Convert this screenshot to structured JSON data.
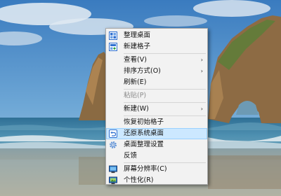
{
  "menu": {
    "items": [
      {
        "label": "整理桌面",
        "icon": "fences-organize-icon"
      },
      {
        "label": "新建格子",
        "icon": "fences-new-icon"
      },
      {
        "label": "查看(V)",
        "submenu": "chevron-right-icon"
      },
      {
        "label": "排序方式(O)",
        "submenu": "chevron-right-icon"
      },
      {
        "label": "刷新(E)"
      },
      {
        "label": "粘贴(P)",
        "state": "disabled"
      },
      {
        "label": "新建(W)",
        "submenu": "chevron-right-icon"
      },
      {
        "label": "恢复初始格子"
      },
      {
        "label": "还原系统桌面",
        "icon": "undo-icon",
        "state": "highlighted"
      },
      {
        "label": "桌面整理设置",
        "icon": "gear-icon"
      },
      {
        "label": "反馈"
      },
      {
        "label": "屏幕分辨率(C)",
        "icon": "display-icon"
      },
      {
        "label": "个性化(R)",
        "icon": "personalize-icon"
      }
    ],
    "arrow_glyph": "›",
    "colors": {
      "background": "#f2f2f2",
      "highlight": "#cce8ff",
      "icon": "#2e6fd0"
    }
  }
}
